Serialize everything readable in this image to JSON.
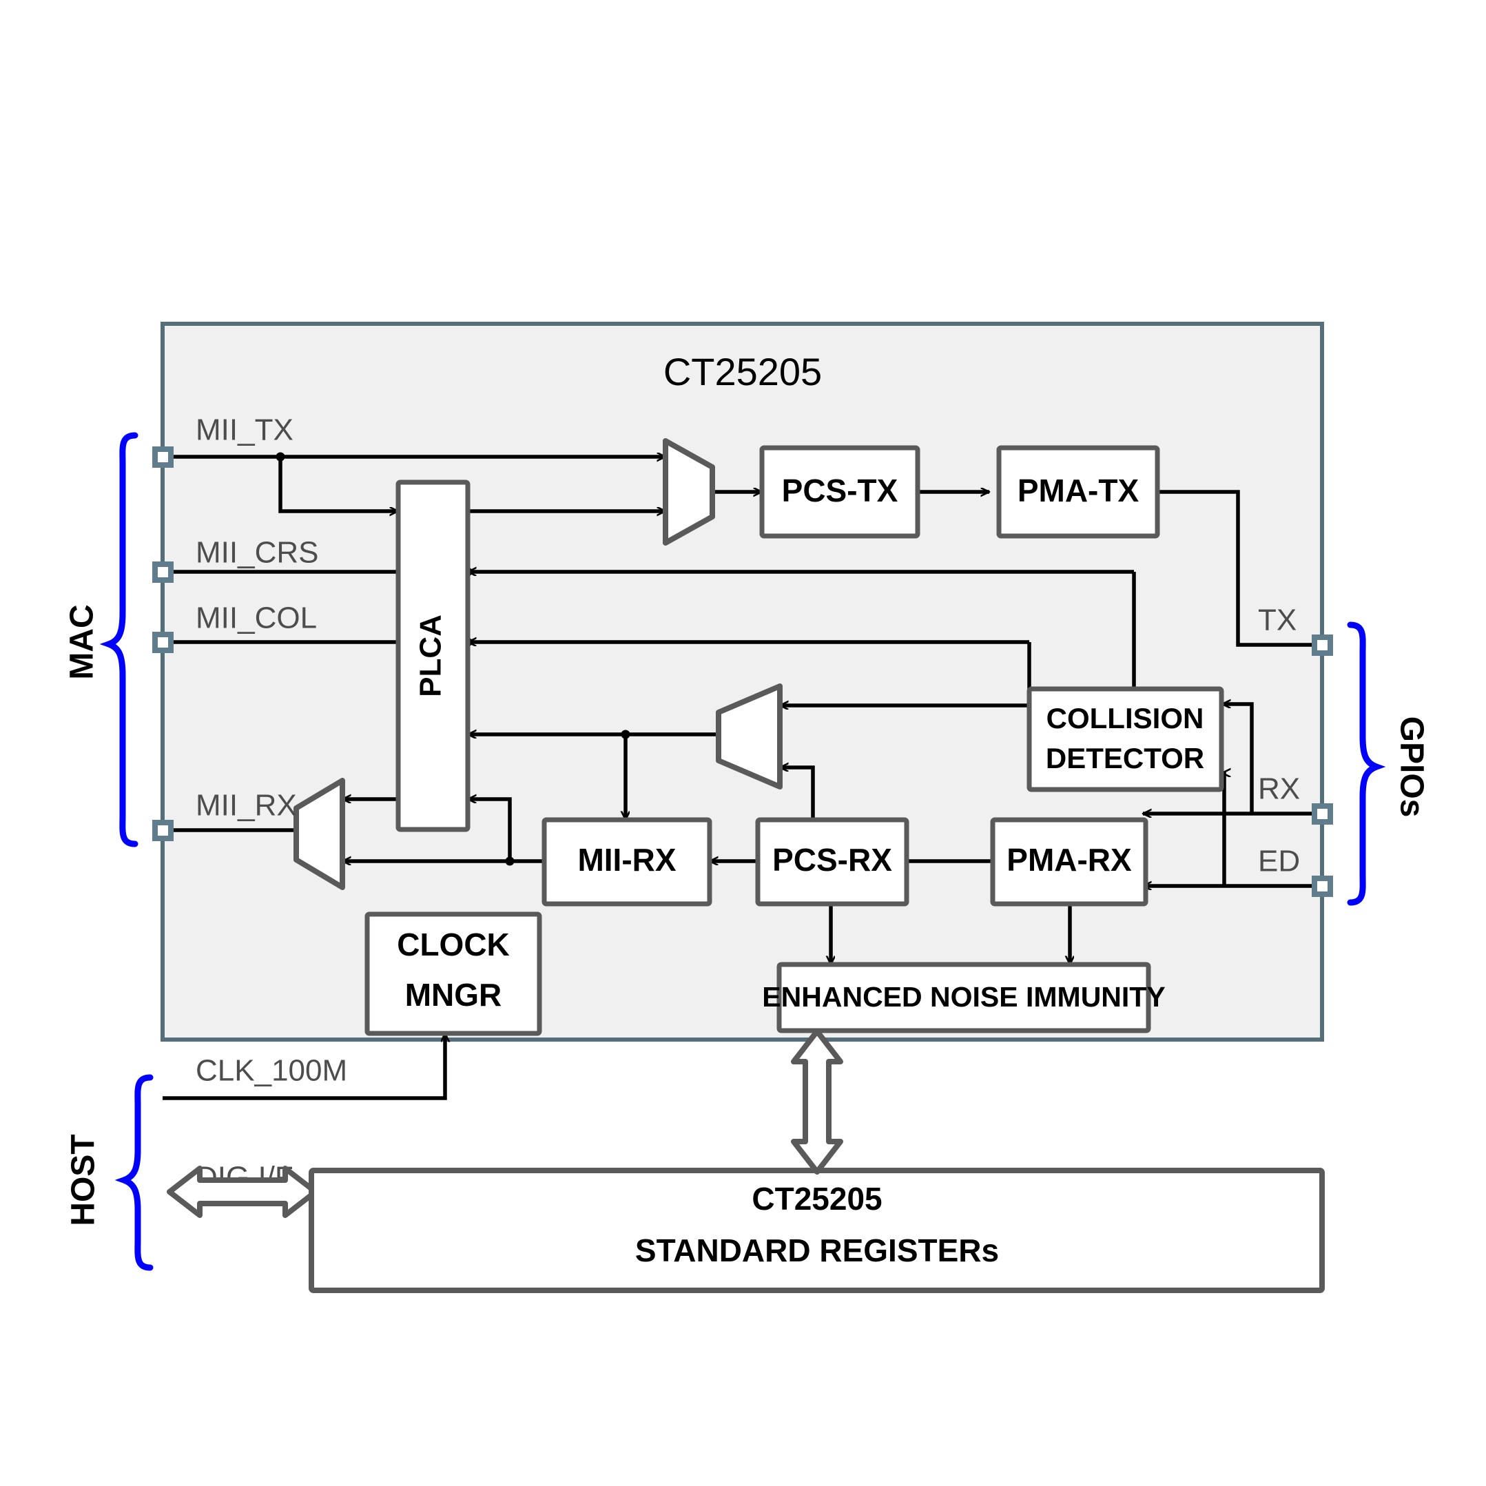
{
  "diagram": {
    "title": "CT25205",
    "chip": {
      "label": "CT25205",
      "fill": "#f0f0f0",
      "stroke": "#546e7a"
    },
    "groups": [
      {
        "id": "mac",
        "label": "MAC",
        "color": "#0000ff"
      },
      {
        "id": "gpios",
        "label": "GPIOs",
        "color": "#0000ff"
      },
      {
        "id": "host",
        "label": "HOST",
        "color": "#0000ff"
      }
    ],
    "blocks": [
      {
        "id": "plca",
        "label": "PLCA",
        "rotated": true
      },
      {
        "id": "pcs_tx",
        "label": "PCS-TX",
        "rotated": false
      },
      {
        "id": "pma_tx",
        "label": "PMA-TX",
        "rotated": false
      },
      {
        "id": "collision",
        "label_line1": "COLLISION",
        "label_line2": "DETECTOR",
        "rotated": false
      },
      {
        "id": "mii_rx",
        "label": "MII-RX",
        "rotated": false
      },
      {
        "id": "pcs_rx",
        "label": "PCS-RX",
        "rotated": false
      },
      {
        "id": "pma_rx",
        "label": "PMA-RX",
        "rotated": false
      },
      {
        "id": "eni",
        "label": "ENHANCED NOISE IMMUNITY",
        "rotated": false
      },
      {
        "id": "clock",
        "label_line1": "CLOCK",
        "label_line2": "MNGR",
        "rotated": false
      },
      {
        "id": "registers",
        "label_line1": "CT25205",
        "label_line2": "STANDARD REGISTERs",
        "rotated": false
      }
    ],
    "muxes": [
      {
        "id": "tx_mux",
        "orientation": "left-wide"
      },
      {
        "id": "rx_mux",
        "orientation": "right-wide"
      },
      {
        "id": "out_mux",
        "orientation": "right-wide"
      }
    ],
    "signals": {
      "mii_tx": "MII_TX",
      "mii_crs": "MII_CRS",
      "mii_col": "MII_COL",
      "mii_rx": "MII_RX",
      "tx": "TX",
      "rx": "RX",
      "ed": "ED",
      "clk_100m": "CLK_100M",
      "dig_if": "DIG I/F"
    },
    "colors": {
      "block_stroke": "#5a5a5a",
      "block_fill": "#ffffff",
      "wire": "#000000",
      "chip_fill": "#f0f0f0",
      "chip_stroke": "#546e7a",
      "pin_stroke": "#5f7d8c",
      "pin_fill": "#ffffff",
      "brace": "#0000ff",
      "label_gray": "#4d4d4d"
    }
  }
}
